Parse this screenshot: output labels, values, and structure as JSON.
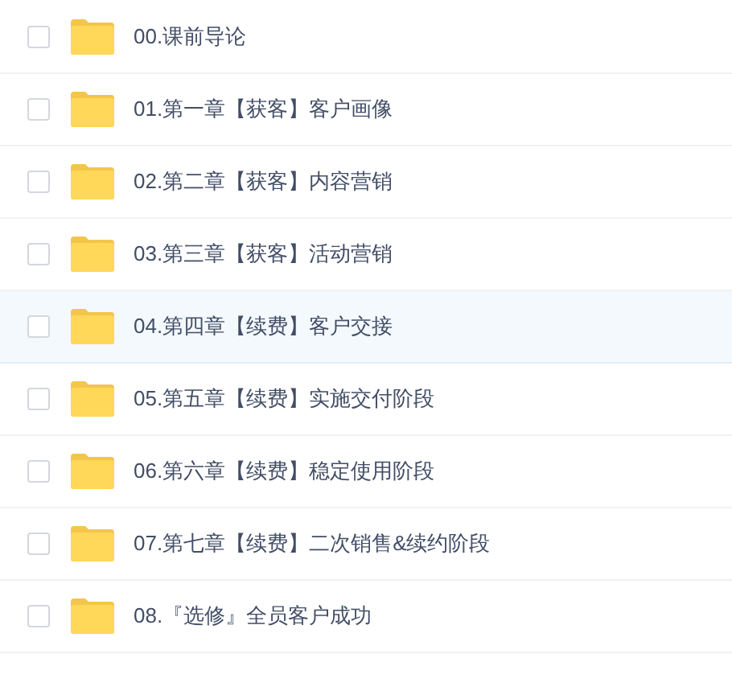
{
  "files": [
    {
      "name": "00.课前导论",
      "checked": false,
      "selected": false
    },
    {
      "name": "01.第一章【获客】客户画像",
      "checked": false,
      "selected": false
    },
    {
      "name": "02.第二章【获客】内容营销",
      "checked": false,
      "selected": false
    },
    {
      "name": "03.第三章【获客】活动营销",
      "checked": false,
      "selected": false
    },
    {
      "name": "04.第四章【续费】客户交接",
      "checked": false,
      "selected": true
    },
    {
      "name": "05.第五章【续费】实施交付阶段",
      "checked": false,
      "selected": false
    },
    {
      "name": "06.第六章【续费】稳定使用阶段",
      "checked": false,
      "selected": false
    },
    {
      "name": "07.第七章【续费】二次销售&续约阶段",
      "checked": false,
      "selected": false
    },
    {
      "name": "08.『选修』全员客户成功",
      "checked": false,
      "selected": false
    }
  ]
}
